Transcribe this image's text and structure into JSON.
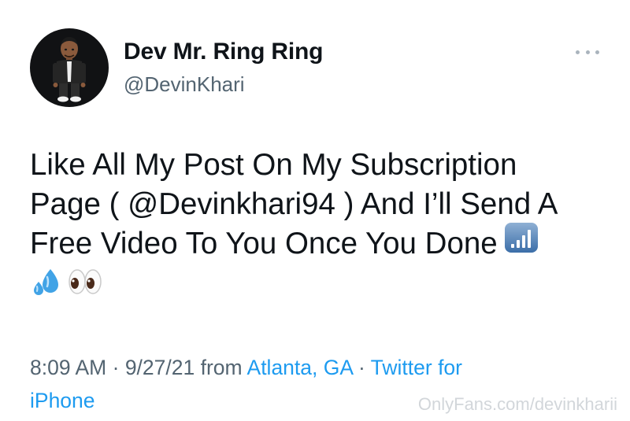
{
  "user": {
    "display_name": "Dev Mr. Ring Ring",
    "handle": "@DevinKhari",
    "avatar_icon": "bitmoji-avatar"
  },
  "tweet": {
    "lines": [
      "Like All My Post On My Subscription",
      "Page ( @Devinkhari94 ) And I’ll Send A",
      "Free Video To You Once You Done"
    ],
    "inline_icon": "signal-strength-icon",
    "emojis": [
      "sweat-droplets-emoji",
      "eyes-emoji"
    ]
  },
  "meta": {
    "time": "8:09 AM",
    "separator": "·",
    "date": "9/27/21",
    "from_label": "from",
    "location": "Atlanta, GA",
    "source_part1": "Twitter for",
    "source_part2": "iPhone"
  },
  "watermark": "OnlyFans.com/devinkharii",
  "colors": {
    "link": "#1d9bf0",
    "secondary_text": "#536471",
    "primary_text": "#0f1419"
  }
}
